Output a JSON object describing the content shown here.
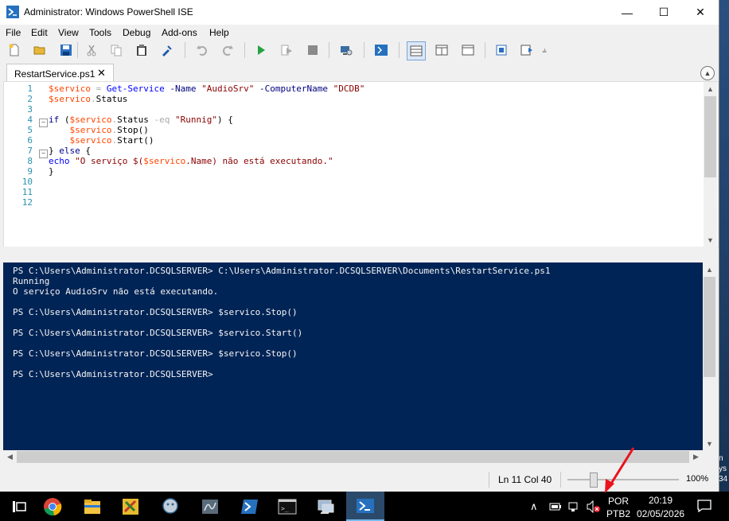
{
  "window": {
    "title": "Administrator: Windows PowerShell ISE",
    "minimize": "—",
    "maximize": "☐",
    "close": "✕"
  },
  "menu": [
    "File",
    "Edit",
    "View",
    "Tools",
    "Debug",
    "Add-ons",
    "Help"
  ],
  "tab": {
    "label": "RestartService.ps1",
    "close": "✕"
  },
  "editor": {
    "line_numbers": [
      "1",
      "2",
      "3",
      "4",
      "5",
      "6",
      "7",
      "8",
      "9",
      "10",
      "11",
      "12"
    ],
    "lines": [
      [
        {
          "t": "$servico",
          "c": "v"
        },
        {
          "t": " "
        },
        {
          "t": "=",
          "c": "op"
        },
        {
          "t": " "
        },
        {
          "t": "Get-Service",
          "c": "cm"
        },
        {
          "t": " "
        },
        {
          "t": "-Name",
          "c": "pm"
        },
        {
          "t": " "
        },
        {
          "t": "\"AudioSrv\"",
          "c": "st"
        },
        {
          "t": " "
        },
        {
          "t": "-ComputerName",
          "c": "pm"
        },
        {
          "t": " "
        },
        {
          "t": "\"DCDB\"",
          "c": "st"
        }
      ],
      [
        {
          "t": "$servico",
          "c": "v"
        },
        {
          "t": ".",
          "c": "op"
        },
        {
          "t": "Status",
          "c": "mb"
        }
      ],
      [],
      [
        {
          "t": "if",
          "c": "kw"
        },
        {
          "t": " ("
        },
        {
          "t": "$servico",
          "c": "v"
        },
        {
          "t": ".",
          "c": "op"
        },
        {
          "t": "Status",
          "c": "mb"
        },
        {
          "t": " "
        },
        {
          "t": "-eq",
          "c": "op"
        },
        {
          "t": " "
        },
        {
          "t": "\"Runnig\"",
          "c": "st"
        },
        {
          "t": ") {"
        }
      ],
      [
        {
          "t": "    "
        },
        {
          "t": "$servico",
          "c": "v"
        },
        {
          "t": ".",
          "c": "op"
        },
        {
          "t": "Stop",
          "c": "mb"
        },
        {
          "t": "()"
        }
      ],
      [
        {
          "t": "    "
        },
        {
          "t": "$servico",
          "c": "v"
        },
        {
          "t": ".",
          "c": "op"
        },
        {
          "t": "Start",
          "c": "mb"
        },
        {
          "t": "()"
        }
      ],
      [
        {
          "t": "} "
        },
        {
          "t": "else",
          "c": "kw"
        },
        {
          "t": " {"
        }
      ],
      [
        {
          "t": "echo",
          "c": "cm"
        },
        {
          "t": " "
        },
        {
          "t": "\"O serviço $(",
          "c": "st"
        },
        {
          "t": "$servico",
          "c": "v"
        },
        {
          "t": ".Name) não está executando.\"",
          "c": "st"
        }
      ],
      [
        {
          "t": "}"
        }
      ],
      [],
      [],
      []
    ]
  },
  "console": {
    "lines": [
      "PS C:\\Users\\Administrator.DCSQLSERVER> C:\\Users\\Administrator.DCSQLSERVER\\Documents\\RestartService.ps1",
      "Running",
      "O serviço AudioSrv não está executando.",
      "",
      "PS C:\\Users\\Administrator.DCSQLSERVER> $servico.Stop()",
      "",
      "PS C:\\Users\\Administrator.DCSQLSERVER> $servico.Start()",
      "",
      "PS C:\\Users\\Administrator.DCSQLSERVER> $servico.Stop()",
      "",
      "PS C:\\Users\\Administrator.DCSQLSERVER>"
    ]
  },
  "status": {
    "position": "Ln 11  Col 40",
    "zoom": "100%",
    "zoom_level": 0.2
  },
  "taskbar": {
    "lang": "POR",
    "layout": "PTB2",
    "time": "20:19",
    "date": "02/05/2026",
    "apps": [
      "task-view-icon",
      "chrome-icon",
      "file-explorer-icon",
      "tools-app-icon",
      "postgres-icon",
      "sql-management-studio-icon",
      "powershell-icon",
      "cmd-icon",
      "network-app-icon",
      "powershell-ise-icon"
    ]
  },
  "desktop": {
    "edge_text": "n\nys\n34"
  },
  "colors": {
    "console_bg": "#012456",
    "annotation_arrow": "#e8141c",
    "selected_taskbar": "#2b4a6b"
  }
}
